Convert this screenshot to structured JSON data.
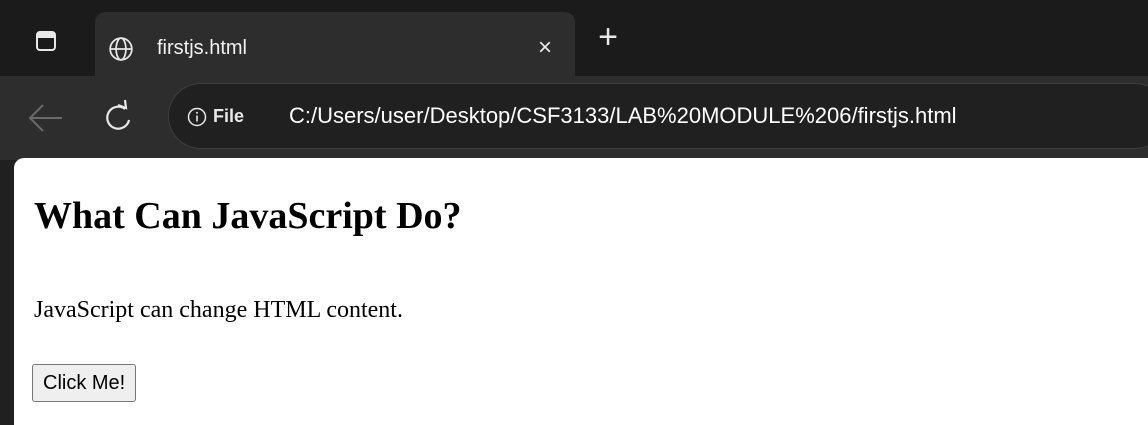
{
  "tab": {
    "title": "firstjs.html",
    "close_glyph": "×",
    "favicon": "globe-icon"
  },
  "tabstrip": {
    "new_tab_glyph": "+"
  },
  "toolbar": {
    "back_icon": "arrow-left-icon",
    "refresh_icon": "refresh-icon"
  },
  "address": {
    "security_label": "File",
    "url": "C:/Users/user/Desktop/CSF3133/LAB%20MODULE%206/firstjs.html"
  },
  "page": {
    "heading": "What Can JavaScript Do?",
    "paragraph": "JavaScript can change HTML content.",
    "button_label": "Click Me!"
  },
  "colors": {
    "tabstrip_bg": "#1b1b1b",
    "toolbar_bg": "#2d2d2d",
    "page_bg": "#ffffff"
  }
}
